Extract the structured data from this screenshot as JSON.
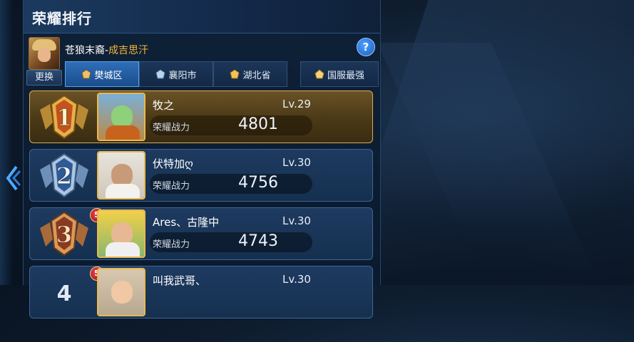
{
  "page": {
    "title": "荣耀排行",
    "change_label": "更换",
    "help_label": "?"
  },
  "player": {
    "name": "苍狼末裔",
    "separator": "-",
    "hero_title": "成吉思汗"
  },
  "tabs": [
    {
      "label": "樊城区",
      "icon": "district-icon",
      "active": true
    },
    {
      "label": "襄阳市",
      "icon": "city-icon",
      "active": false
    },
    {
      "label": "湖北省",
      "icon": "province-icon",
      "active": false
    },
    {
      "label": "国服最强",
      "icon": "national-icon",
      "active": false
    }
  ],
  "rankings": [
    {
      "rank": "1",
      "name": "牧之",
      "level": "Lv.29",
      "score_label": "荣耀战力",
      "score": "4801",
      "badge": ""
    },
    {
      "rank": "2",
      "name": "伏特加ღ",
      "level": "Lv.30",
      "score_label": "荣耀战力",
      "score": "4756",
      "badge": ""
    },
    {
      "rank": "3",
      "name": "Ares、古隆中",
      "level": "Lv.30",
      "score_label": "荣耀战力",
      "score": "4743",
      "badge": "5"
    },
    {
      "rank": "4",
      "name": "叫我武哥、",
      "level": "Lv.30",
      "score_label": "",
      "score": "",
      "badge": "5"
    }
  ],
  "colors": {
    "accent_blue": "#2e6fb8",
    "gold": "#e9b94e",
    "title_orange": "#f4b63a",
    "background": "#0e1c2e"
  }
}
